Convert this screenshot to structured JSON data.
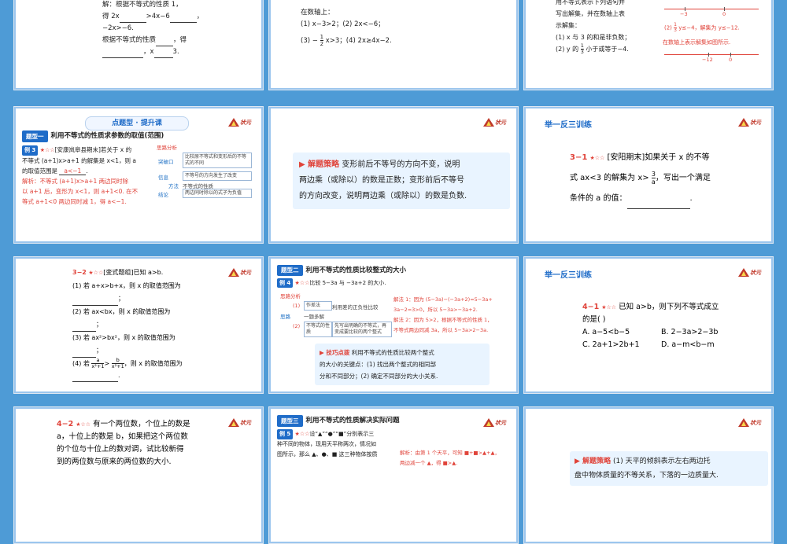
{
  "slides": {
    "s1": {
      "line1": "解：根据不等式的性质 1，",
      "line2a": "得 2x",
      "line2b": ">4x−6",
      "line2c": "，",
      "line3": "−2x>−6.",
      "line4a": "根据不等式的性质",
      "line4b": "，得",
      "line5a": "，x",
      "line5b": "3."
    },
    "s2": {
      "line1": "在数轴上：",
      "line2": "(1) x−3>2；(2) 2x<−6；",
      "line3a": "(3) −",
      "frac_num": "1",
      "frac_den": "2",
      "line3b": "x>3；(4) 2x≥4x−2."
    },
    "s3": {
      "line1": "用不等式表示下列语句并",
      "line2": "写出解集，并在数轴上表",
      "line3": "示解集：",
      "line4": "(1) x 与 3 的和是非负数；",
      "line5a": "(2) y 的",
      "frac_num": "1",
      "frac_den": "3",
      "line5b": "小于或等于−4.",
      "nl1_left": "−3",
      "nl1_right": "0",
      "ans2a": "(2)",
      "ans2_frac_num": "1",
      "ans2_frac_den": "3",
      "ans2b": "y≤−4，解集为 y≤−12.",
      "ans3": "在数轴上表示解集如图所示.",
      "nl2_left": "−12",
      "nl2_right": "0"
    },
    "s4": {
      "banner": "点题型 · 提升课",
      "band_tag": "题型一",
      "band_title": "利用不等式的性质求参数的取值(范围)",
      "ex_label": "例 3",
      "stars": "★☆☆",
      "source": "[安康岚皋县期末]",
      "q1": "若关于 x 的",
      "q2": "不等式 (a+1)x>a+1 的解集是 x<1，则 a",
      "q3a": "的取值范围是",
      "q3ans": "a<−1",
      "q3b": ".",
      "sol1": "解析：不等式 (a+1)x>a+1 两边同时除",
      "sol2": "以 a+1 后，变形为 x<1，则 a+1<0. 在不",
      "sol3": "等式 a+1<0 两边同时减 1，得 a<−1.",
      "map_title": "思路分析",
      "map_key": "突破口",
      "map_key_text": "比较原不等式和变形后的不等式的不同",
      "map_info": "信息",
      "map_info_text": "不等号的方向发生了改变",
      "map_sub": "不等式的性质",
      "map_method": "方法",
      "map_goal": "结论",
      "map_goal_text": "两边同时除以的式子为负值"
    },
    "s5": {
      "title": "解题策略",
      "line1": "变形前后不等号的方向不变，说明",
      "line2": "两边乘（或除以）的数是正数；变形前后不等号",
      "line3": "的方向改变，说明两边乘（或除以）的数是负数."
    },
    "s6": {
      "section": "举一反三训练",
      "num": "3−1",
      "stars": "★☆☆",
      "source": "[安阳期末]",
      "q1": "如果关于 x 的不等",
      "q2a": "式 ax<3 的解集为 x>",
      "frac_num": "3",
      "frac_den": "a",
      "q2b": "，写出一个满足",
      "q3": "条件的 a 的值：",
      "q3end": "."
    },
    "s7": {
      "num": "3−2",
      "stars": "★☆☆",
      "source": "[变式题组]",
      "q0": "已知 a>b.",
      "q1": "(1) 若 a+x>b+x，则 x 的取值范围为",
      "q1b": "；",
      "q2": "(2) 若 ax<bx，则 x 的取值范围为",
      "q2b": "；",
      "q3": "(3) 若 ax²>bx²，则 x 的取值范围为",
      "q3b": "；",
      "q4a": "(4) 若",
      "q4_n1": "a",
      "q4_d1": "x²+1",
      "q4_mid": ">",
      "q4_n2": "b",
      "q4_d2": "x²+1",
      "q4b": "，则 x 的取值范围为",
      "q4c": "."
    },
    "s8": {
      "band_tag": "题型二",
      "band_title": "利用不等式的性质比较整式的大小",
      "ex_label": "例 4",
      "stars": "★☆☆",
      "q": "比较 5−3a 与 −3a+2 的大小.",
      "map_title": "思路分析",
      "step1": "(1)",
      "step1_text": "作差法",
      "step1_detail": "利用差的正负性比较",
      "step_sub": "一题多解",
      "step2": "(2)",
      "step2_text": "不等式的性质",
      "step2_detail": "先写出明确的不等式，再变成要比较的两个整式",
      "map_left": "思路",
      "sol1": "解法 1：因为 (5−3a)−(−3a+2)=5−3a+",
      "sol2": "3a−2=3>0，所以 5−3a>−3a+2.",
      "sol3": "解法 2：因为 5>2，根据不等式的性质 1，",
      "sol4": "不等式两边同减 3a，所以 5−3a>2−3a.",
      "tip_title": "技巧点拨",
      "tip1": "利用不等式的性质比较两个整式",
      "tip2": "的大小的关键点：(1) 找出两个整式的相同部",
      "tip3": "分和不同部分；(2) 确定不同部分的大小关系."
    },
    "s9": {
      "section": "举一反三训练",
      "num": "4−1",
      "stars": "★☆☆",
      "q1": "已知 a>b，则下列不等式成立",
      "q2": "的是(    )",
      "optA": "A. a−5<b−5",
      "optB": "B. 2−3a>2−3b",
      "optC": "C. 2a+1>2b+1",
      "optD": "D. a−m<b−m"
    },
    "s10": {
      "num": "4−2",
      "stars": "★☆☆",
      "q1": "有一个两位数，个位上的数是",
      "q2": "a，十位上的数是 b，如果把这个两位数",
      "q3": "的个位与十位上的数对调，试比较新得",
      "q4": "到的两位数与原来的两位数的大小."
    },
    "s11": {
      "band_tag": "题型三",
      "band_title": "利用不等式的性质解决实际问题",
      "ex_label": "例 5",
      "stars": "★☆☆",
      "q1": "设“▲”“●”“■”分别表示三",
      "q2": "种不同的物体，现用天平称两次，情况如",
      "q3": "图所示，那么 ▲、●、■ 这三种物体按质",
      "sol1": "解析：由第 1 个天平，可知 ■+■>▲+▲，",
      "sol2": "两边减一个 ▲，得 ■>▲."
    },
    "s12": {
      "title": "解题策略",
      "line1": "(1) 天平的倾斜表示左右两边托",
      "line2": "盘中物体质量的不等关系，下落的一边质量大."
    },
    "logo": {
      "brand": "状元",
      "sub": "状元成才路"
    }
  }
}
